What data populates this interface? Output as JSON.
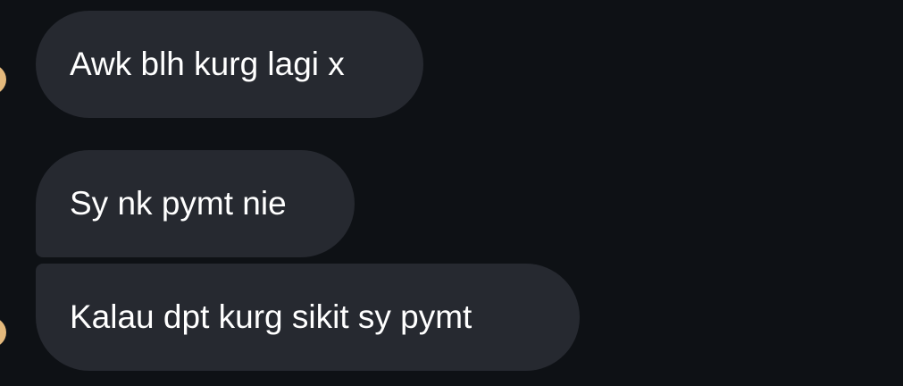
{
  "conversation": {
    "messages": [
      {
        "text": "Awk blh kurg lagi x"
      },
      {
        "text": "Sy nk pymt nie"
      },
      {
        "text": "Kalau dpt kurg sikit sy pymt"
      }
    ]
  },
  "colors": {
    "background": "#0e1115",
    "bubble": "#262930",
    "text": "#ffffff",
    "avatar": "#e4b97c"
  }
}
